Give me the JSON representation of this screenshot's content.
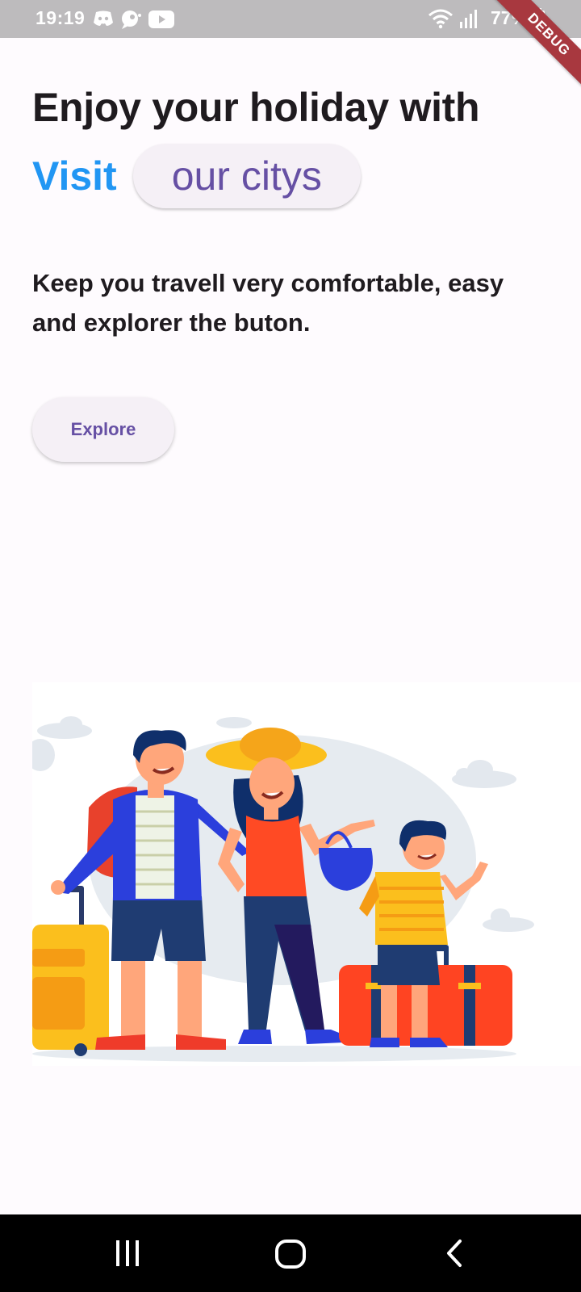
{
  "status_bar": {
    "time": "19:19",
    "battery_percent": "77%",
    "icons": [
      "discord-icon",
      "chat-bubble-icon",
      "youtube-icon",
      "wifi-icon",
      "signal-icon",
      "battery-charging-icon"
    ]
  },
  "debug_banner": "DEBUG",
  "hero": {
    "line1": "Enjoy your holiday with",
    "visit_word": "Visit",
    "city_chip_label": "our citys",
    "description": "Keep you travell very comfortable, easy and explorer the buton.",
    "explore_button": "Explore"
  },
  "illustration": {
    "subject": "family-travel-illustration"
  },
  "nav_bar": {
    "icons": [
      "recent-apps-icon",
      "home-icon",
      "back-icon"
    ]
  },
  "colors": {
    "accent_blue": "#2196f3",
    "primary_purple": "#6650a4",
    "chip_background": "#f5f0f6",
    "page_background": "#fefbfe",
    "status_bar": "#bdbbbd",
    "debug_ribbon": "#a8383f"
  }
}
